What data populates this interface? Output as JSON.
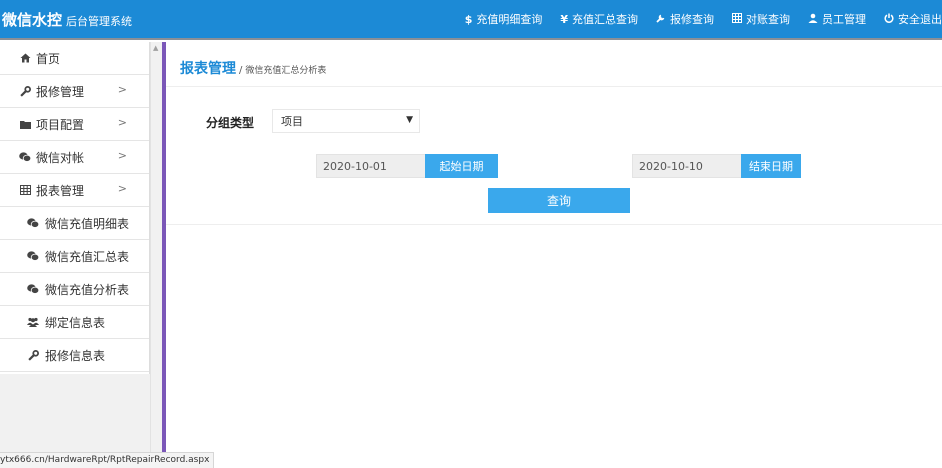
{
  "header": {
    "title": "微信水控",
    "subtitle": "后台管理系统",
    "nav": [
      {
        "icon": "dollar-icon",
        "glyph": "$",
        "label": "充值明细查询"
      },
      {
        "icon": "yen-icon",
        "glyph": "¥",
        "label": "充值汇总查询"
      },
      {
        "icon": "wrench-icon",
        "glyph": "🔧",
        "label": "报修查询"
      },
      {
        "icon": "table-icon",
        "glyph": "▦",
        "label": "对账查询"
      },
      {
        "icon": "user-icon",
        "glyph": "👤",
        "label": "员工管理"
      },
      {
        "icon": "power-icon",
        "glyph": "⏻",
        "label": "安全退出"
      }
    ]
  },
  "sidebar": {
    "items": [
      {
        "icon": "home-icon",
        "label": "首页",
        "chevron": ""
      },
      {
        "icon": "wrench-icon",
        "label": "报修管理",
        "chevron": ">"
      },
      {
        "icon": "folder-icon",
        "label": "项目配置",
        "chevron": ">"
      },
      {
        "icon": "wechat-icon",
        "label": "微信对帐",
        "chevron": ">"
      },
      {
        "icon": "table-icon",
        "label": "报表管理",
        "chevron": ">"
      }
    ],
    "subitems": [
      {
        "icon": "wechat-icon",
        "label": "微信充值明细表"
      },
      {
        "icon": "wechat-icon",
        "label": "微信充值汇总表"
      },
      {
        "icon": "wechat-icon",
        "label": "微信充值分析表"
      },
      {
        "icon": "users-icon",
        "label": "绑定信息表"
      },
      {
        "icon": "wrench-icon",
        "label": "报修信息表"
      }
    ]
  },
  "main": {
    "breadcrumb_title": "报表管理",
    "breadcrumb_sep": "/",
    "breadcrumb_sub": "微信充值汇总分析表",
    "group_label": "分组类型",
    "group_value": "项目",
    "start_date": "2020-10-01",
    "start_button": "起始日期",
    "end_date": "2020-10-10",
    "end_button": "结束日期",
    "query_button": "查询"
  },
  "status": {
    "url": "ytx666.cn/HardwareRpt/RptRepairRecord.aspx"
  },
  "colors": {
    "header_bg": "#1c8ad6",
    "accent_button": "#3aa8ec",
    "divider": "#7b57b8"
  }
}
